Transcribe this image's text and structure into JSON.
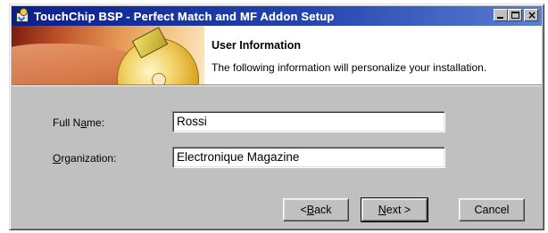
{
  "window": {
    "title": "TouchChip BSP - Perfect Match and MF Addon  Setup",
    "controls": {
      "minimize_icon": "minimize-icon",
      "maximize_icon": "maximize-icon",
      "close_icon": "close-icon"
    }
  },
  "banner": {
    "title": "User Information",
    "subtitle": "The following information will personalize your installation."
  },
  "form": {
    "full_name": {
      "label_pre": "Full N",
      "label_access": "a",
      "label_post": "me:",
      "value": "Rossi"
    },
    "organization": {
      "label_pre": "",
      "label_access": "O",
      "label_post": "rganization:",
      "value": "Electronique Magazine"
    }
  },
  "buttons": {
    "back": {
      "pre": "< ",
      "access": "B",
      "post": "ack"
    },
    "next": {
      "pre": "",
      "access": "N",
      "post": "ext >"
    },
    "cancel": {
      "label": "Cancel"
    }
  },
  "colors": {
    "titlebar_start": "#0b1f8c",
    "titlebar_end": "#5a7fd0",
    "dialog_face": "#c0c0c0"
  }
}
